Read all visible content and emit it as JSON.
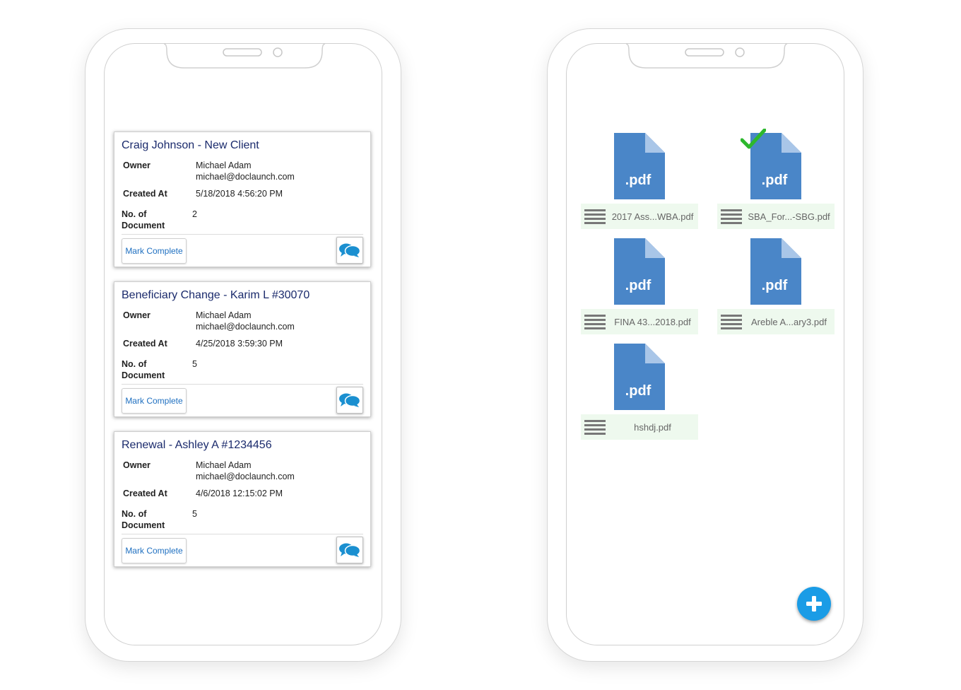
{
  "cards": [
    {
      "title": "Craig Johnson - New Client",
      "owner_label": "Owner",
      "owner_name": "Michael Adam",
      "owner_email": "michael@doclaunch.com",
      "created_label": "Created At",
      "created_value": "5/18/2018 4:56:20 PM",
      "docs_label_1": "No. of",
      "docs_label_2": "Document",
      "docs_value": "2",
      "mark_complete": "Mark Complete"
    },
    {
      "title": "Beneficiary Change - Karim L #30070",
      "owner_label": "Owner",
      "owner_name": "Michael Adam",
      "owner_email": "michael@doclaunch.com",
      "created_label": "Created At",
      "created_value": "4/25/2018 3:59:30 PM",
      "docs_label_1": "No. of",
      "docs_label_2": "Document",
      "docs_value": "5",
      "mark_complete": "Mark Complete"
    },
    {
      "title": "Renewal - Ashley A #1234456",
      "owner_label": "Owner",
      "owner_name": "Michael Adam",
      "owner_email": "michael@doclaunch.com",
      "created_label": "Created At",
      "created_value": "4/6/2018 12:15:02 PM",
      "docs_label_1": "No. of",
      "docs_label_2": "Document",
      "docs_value": "5",
      "mark_complete": "Mark Complete"
    }
  ],
  "files": [
    {
      "name": "2017 Ass...WBA.pdf",
      "ext": ".pdf",
      "checked": false
    },
    {
      "name": "SBA_For...-SBG.pdf",
      "ext": ".pdf",
      "checked": true
    },
    {
      "name": "FINA 43...2018.pdf",
      "ext": ".pdf",
      "checked": false
    },
    {
      "name": "Areble A...ary3.pdf",
      "ext": ".pdf",
      "checked": false
    },
    {
      "name": "hshdj.pdf",
      "ext": ".pdf",
      "checked": false
    }
  ],
  "icons": {
    "chat": "chat-bubbles-icon",
    "file": "pdf-file-icon",
    "menu": "hamburger-menu-icon",
    "check": "checkmark-icon",
    "add": "plus-icon"
  },
  "colors": {
    "title": "#1a2a6c",
    "link": "#1e6fc0",
    "pdf": "#4a86c8",
    "pdf_fold": "#a9c6e8",
    "file_bar": "#eef9ee",
    "check": "#2db82d",
    "fab": "#1a9ce6"
  }
}
